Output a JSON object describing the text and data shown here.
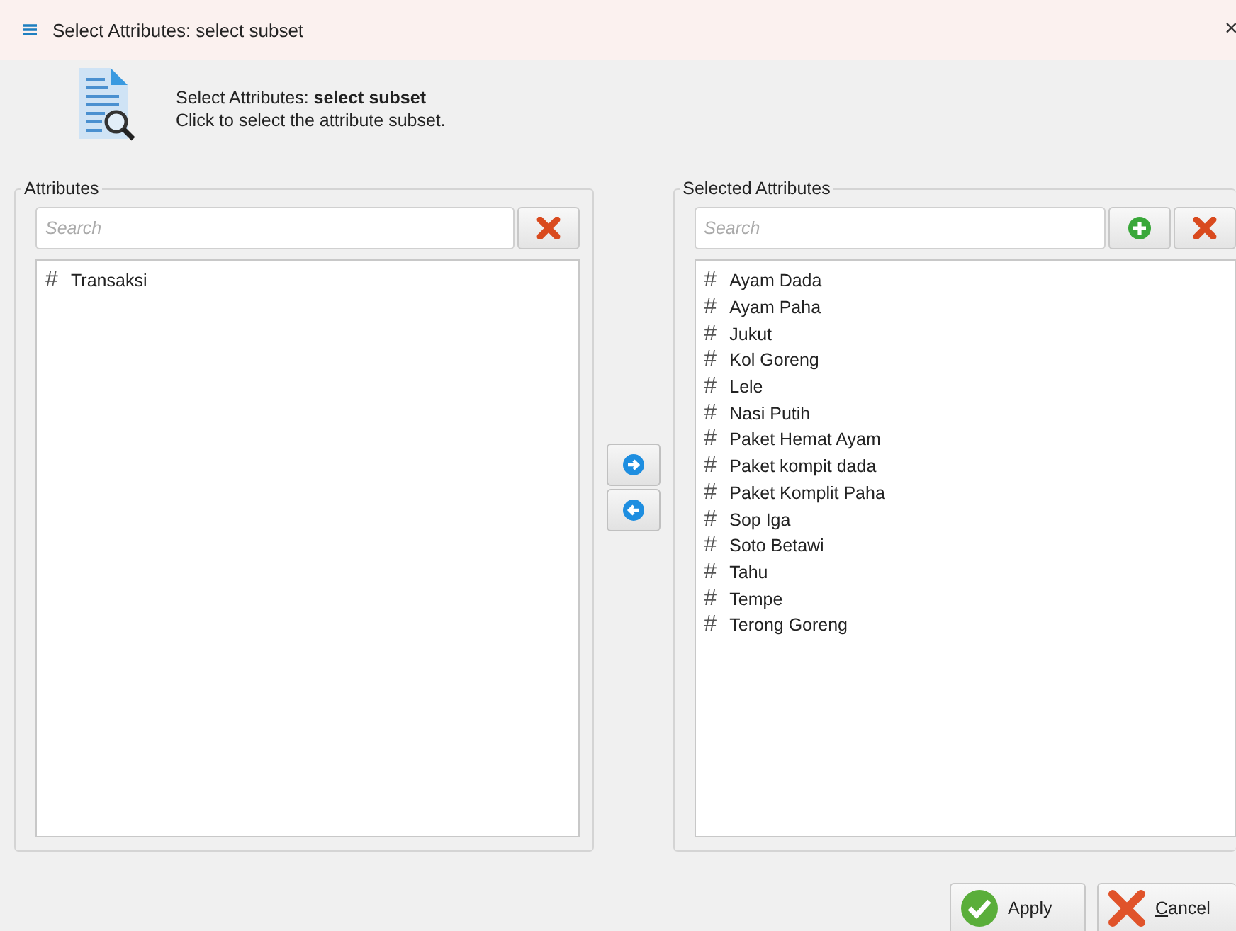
{
  "window": {
    "title": "Select Attributes: select subset",
    "close": "×"
  },
  "header": {
    "title": "Select Attributes: **select subset**",
    "subtitle": "Click to select the attribute subset."
  },
  "attributes": {
    "label": "Attributes",
    "search": {
      "placeholder": "Search"
    },
    "items": [
      {
        "icon": "#",
        "name": "Transaksi"
      }
    ]
  },
  "selected_attributes": {
    "label": "Selected Attributes",
    "search": {
      "placeholder": "Search"
    },
    "items": [
      {
        "icon": "#",
        "name": "Ayam Dada"
      },
      {
        "icon": "#",
        "name": "Ayam Paha"
      },
      {
        "icon": "#",
        "name": "Jukut"
      },
      {
        "icon": "#",
        "name": "Kol Goreng"
      },
      {
        "icon": "#",
        "name": "Lele"
      },
      {
        "icon": "#",
        "name": "Nasi Putih"
      },
      {
        "icon": "#",
        "name": "Paket Hemat Ayam"
      },
      {
        "icon": "#",
        "name": "Paket kompit dada"
      },
      {
        "icon": "#",
        "name": "Paket Komplit Paha"
      },
      {
        "icon": "#",
        "name": "Sop Iga"
      },
      {
        "icon": "#",
        "name": "Soto Betawi"
      },
      {
        "icon": "#",
        "name": "Tahu"
      },
      {
        "icon": "#",
        "name": "Tempe"
      },
      {
        "icon": "#",
        "name": "Terong Goreng"
      }
    ]
  },
  "buttons": [
    {
      "kind": "apply",
      "label": "Apply"
    },
    {
      "kind": "cancel",
      "label": "Cancel"
    }
  ]
}
